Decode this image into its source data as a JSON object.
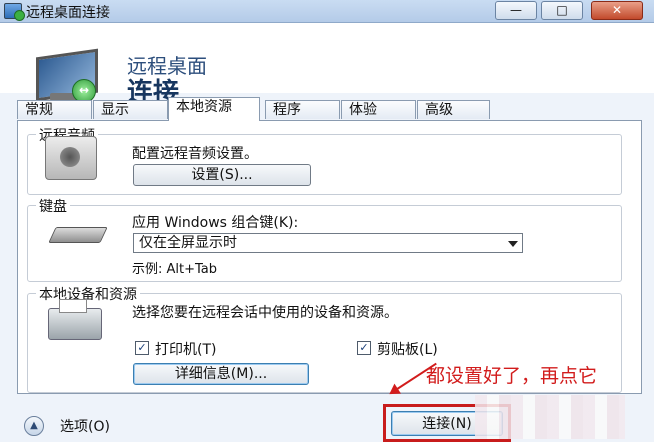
{
  "window": {
    "title": "远程桌面连接",
    "min_label": "—",
    "max_label": "□",
    "close_label": "✕"
  },
  "header": {
    "line1": "远程桌面",
    "line2": "连接"
  },
  "tabs": [
    {
      "label": "常规",
      "active": false
    },
    {
      "label": "显示",
      "active": false
    },
    {
      "label": "本地资源",
      "active": true
    },
    {
      "label": "程序",
      "active": false
    },
    {
      "label": "体验",
      "active": false
    },
    {
      "label": "高级",
      "active": false
    }
  ],
  "audio": {
    "group_label": "远程音频",
    "description": "配置远程音频设置。",
    "settings_button": "设置(S)..."
  },
  "keyboard": {
    "group_label": "键盘",
    "description": "应用 Windows 组合键(K):",
    "selected_option": "仅在全屏显示时",
    "example": "示例: Alt+Tab"
  },
  "devices": {
    "group_label": "本地设备和资源",
    "description": "选择您要在远程会话中使用的设备和资源。",
    "printer_label": "打印机(T)",
    "printer_checked": true,
    "clipboard_label": "剪贴板(L)",
    "clipboard_checked": true,
    "details_button": "详细信息(M)..."
  },
  "footer": {
    "options_label": "选项(O)",
    "connect_button": "连接(N)"
  },
  "annotation": {
    "text": "都设置好了，再点它",
    "color": "#d21c1c"
  },
  "icons": {
    "app": "remote-desktop-icon",
    "options": "chevron-up-icon"
  }
}
